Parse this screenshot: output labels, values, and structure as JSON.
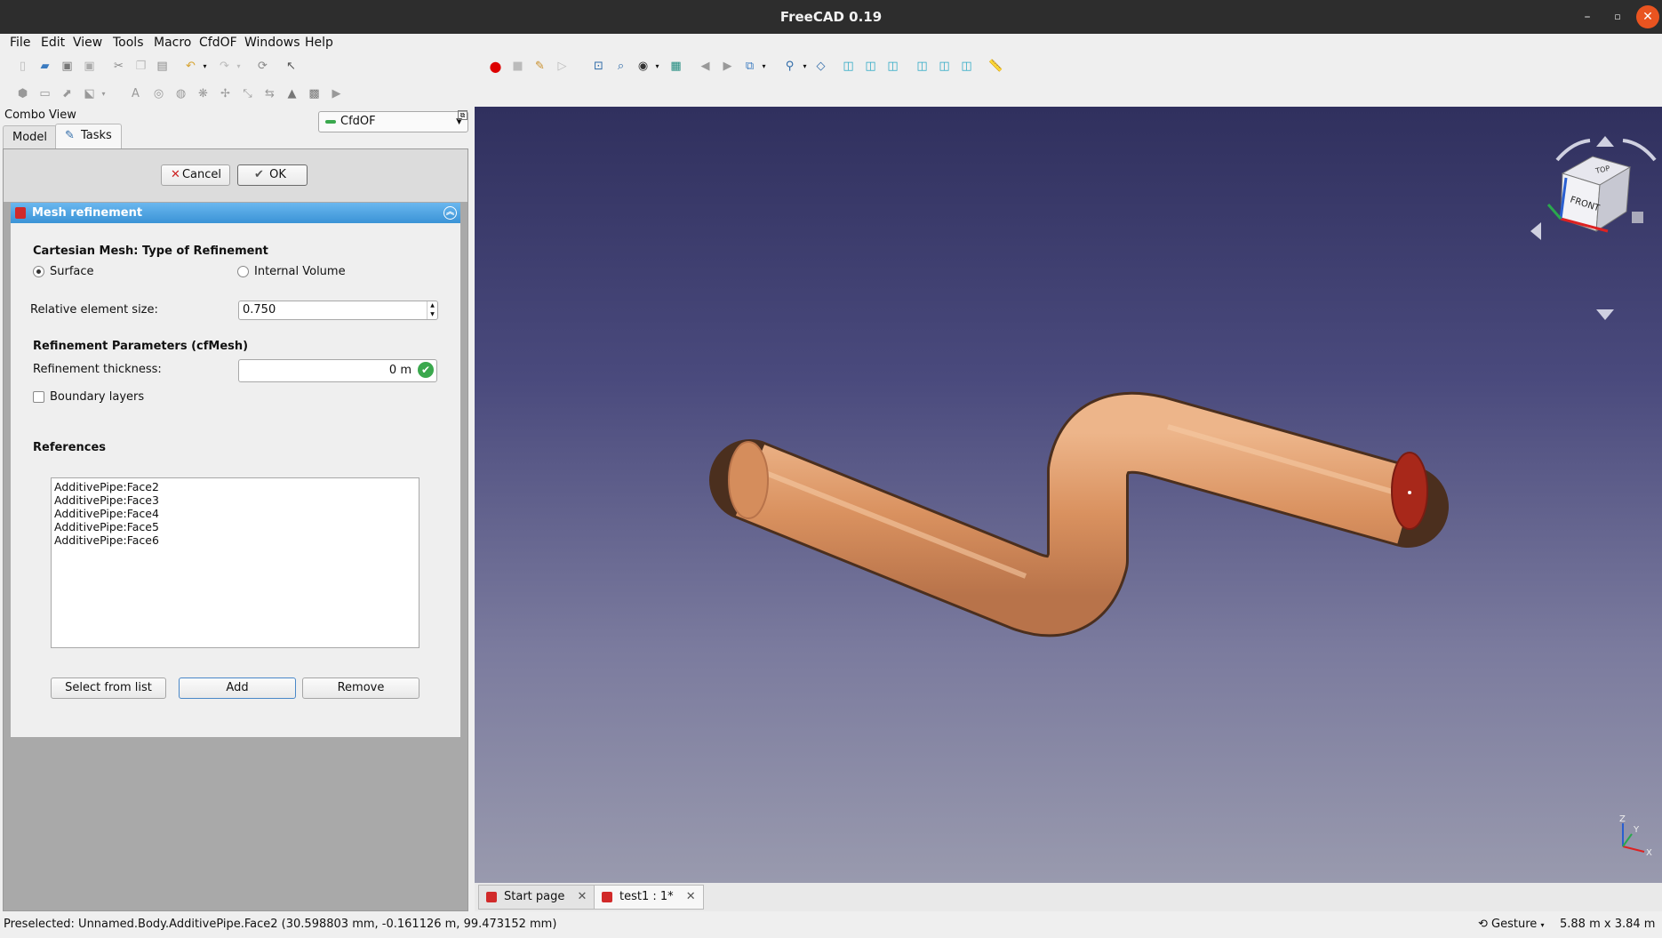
{
  "window": {
    "title": "FreeCAD 0.19"
  },
  "menu": [
    "File",
    "Edit",
    "View",
    "Tools",
    "Macro",
    "CfdOF",
    "Windows",
    "Help"
  ],
  "workbench": {
    "selected": "CfdOF"
  },
  "combo_view": {
    "title": "Combo View",
    "tabs": [
      "Model",
      "Tasks"
    ],
    "cancel_label": "Cancel",
    "ok_label": "OK"
  },
  "task": {
    "header": "Mesh refinement",
    "refinement_type_title": "Cartesian Mesh: Type of Refinement",
    "option_surface": "Surface",
    "option_internal": "Internal Volume",
    "rel_size_label": "Relative element size:",
    "rel_size_value": "0.750",
    "params_title": "Refinement Parameters (cfMesh)",
    "thickness_label": "Refinement thickness:",
    "thickness_value": "0 m",
    "boundary_layers_label": "Boundary layers",
    "references_title": "References",
    "references": [
      "AdditivePipe:Face2",
      "AdditivePipe:Face3",
      "AdditivePipe:Face4",
      "AdditivePipe:Face5",
      "AdditivePipe:Face6"
    ],
    "select_from_list_label": "Select from list",
    "add_label": "Add",
    "remove_label": "Remove"
  },
  "viewport": {
    "navcube_face_front": "FRONT",
    "navcube_face_top": "TOP",
    "axis_x": "X",
    "axis_y": "Y",
    "axis_z": "Z",
    "pipe_color": "#d9915f",
    "selected_face_color": "#a8281a"
  },
  "doc_tabs": [
    "Start page",
    "test1 : 1*"
  ],
  "status": {
    "message": "Preselected: Unnamed.Body.AdditivePipe.Face2 (30.598803 mm, -0.161126 m, 99.473152 mm)",
    "nav_style": "Gesture",
    "dimensions": "5.88 m x 3.84 m"
  }
}
